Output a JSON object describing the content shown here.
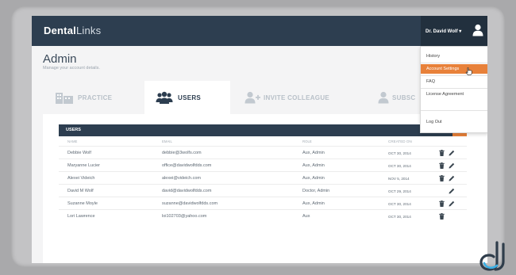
{
  "app": {
    "logo_bold": "Dental",
    "logo_light": "Links"
  },
  "user_menu": {
    "name": "Dr. David Wolf",
    "caret": "▾",
    "avatar_icon": "user-avatar-icon",
    "items": [
      "History",
      "Account Settings",
      "FAQ",
      "License Agreement",
      "Log Out"
    ],
    "active_item": "Account Settings"
  },
  "page": {
    "title": "Admin",
    "subtitle": "Manage your account details."
  },
  "tabs": [
    {
      "label": "PRACTICE",
      "icon": "practice-building-icon",
      "active": false
    },
    {
      "label": "USERS",
      "icon": "users-icon",
      "active": true
    },
    {
      "label": "INVITE COLLEAGUE",
      "icon": "invite-user-icon",
      "active": false
    },
    {
      "label": "SUBSC",
      "icon": "subscription-user-icon",
      "active": false
    }
  ],
  "users_panel": {
    "title": "USERS",
    "add_icon": "add-user-icon",
    "columns": [
      "NAME",
      "EMAIL",
      "ROLE",
      "CREATED ON"
    ],
    "rows": [
      {
        "name": "Debbie Wolf",
        "email": "debbie@3wolfs.com",
        "role": "Aux, Admin",
        "created": "OCT 30, 2014",
        "delete": true,
        "edit": true
      },
      {
        "name": "Maryanne Lucier",
        "email": "office@davidwolfdds.com",
        "role": "Aux, Admin",
        "created": "OCT 30, 2014",
        "delete": true,
        "edit": true
      },
      {
        "name": "Alexei Videich",
        "email": "alexei@videich.com",
        "role": "Aux, Admin",
        "created": "NOV 5, 2014",
        "delete": true,
        "edit": true
      },
      {
        "name": "David M Wolf",
        "email": "david@davidwolfdds.com",
        "role": "Doctor, Admin",
        "created": "OCT 29, 2014",
        "delete": false,
        "edit": true
      },
      {
        "name": "Suzanne Moyle",
        "email": "suzanne@davidwolfdds.com",
        "role": "Aux, Admin",
        "created": "OCT 30, 2014",
        "delete": true,
        "edit": true
      },
      {
        "name": "Lori Lawrence",
        "email": "loi102703@yahoo.com",
        "role": "Aux",
        "created": "OCT 30, 2014",
        "delete": true,
        "edit": false
      }
    ]
  },
  "colors": {
    "navbar": "#2d3e50",
    "accent": "#e8813a"
  },
  "watermark": {
    "icon": "dl-logo-watermark"
  }
}
